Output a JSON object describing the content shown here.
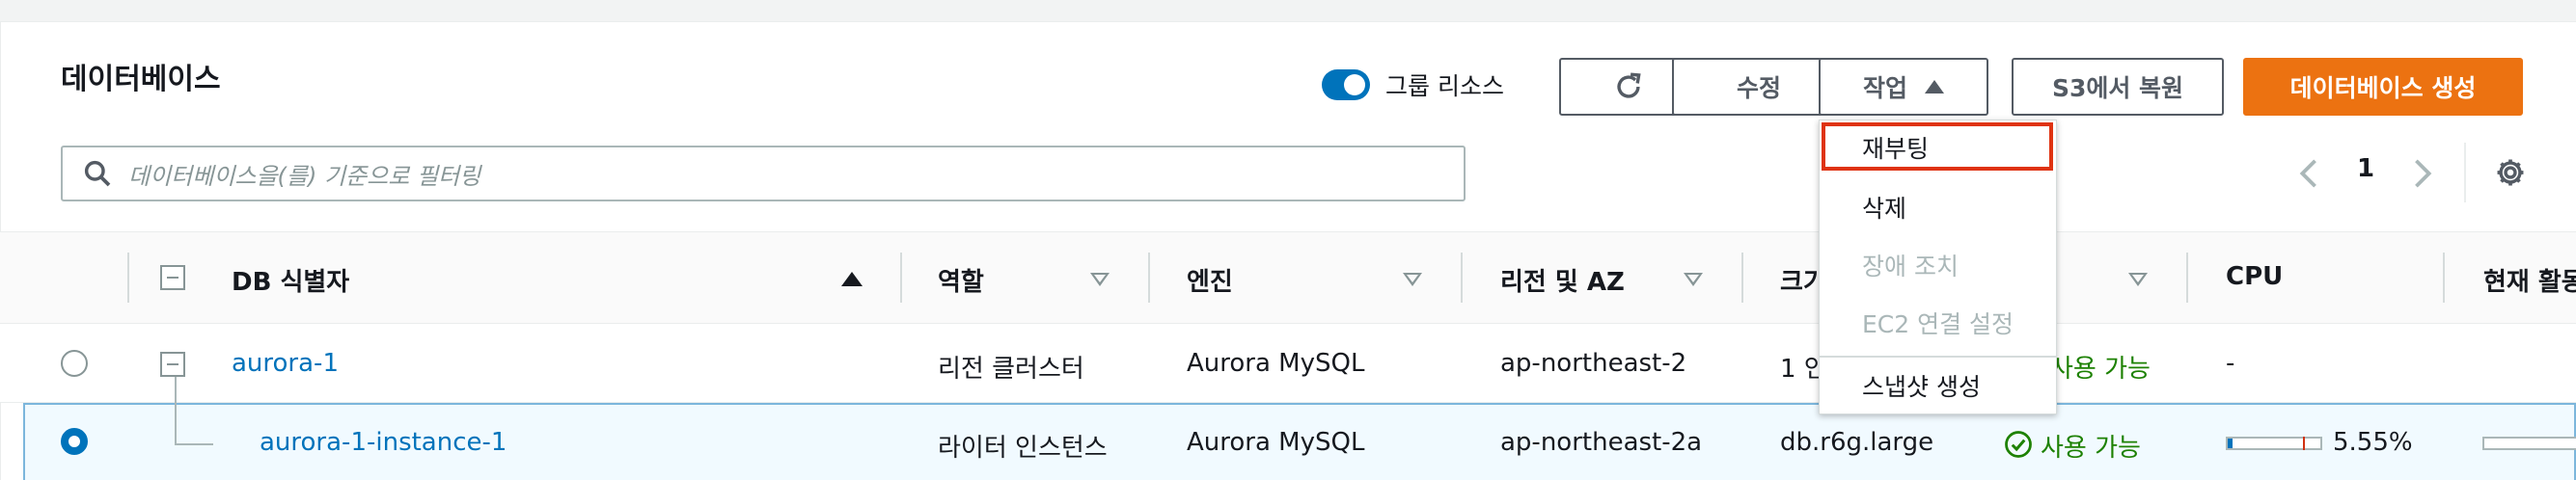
{
  "header": {
    "title": "데이터베이스",
    "group_toggle_label": "그룹 리소스",
    "buttons": {
      "modify": "수정",
      "actions": "작업",
      "restore_s3": "S3에서 복원",
      "create": "데이터베이스 생성"
    }
  },
  "filter": {
    "placeholder": "데이터베이스을(를) 기준으로 필터링"
  },
  "pager": {
    "page": "1"
  },
  "columns": {
    "db_id": "DB 식별자",
    "role": "역할",
    "engine": "엔진",
    "region": "리전 및 AZ",
    "size": "크기",
    "cpu": "CPU",
    "activity": "현재 활동"
  },
  "rows": [
    {
      "db_id": "aurora-1",
      "role": "리전 클러스터",
      "engine": "Aurora MySQL",
      "region": "ap-northeast-2",
      "size": "1 인",
      "status": "사용 가능",
      "cpu": "-"
    },
    {
      "db_id": "aurora-1-instance-1",
      "role": "라이터 인스턴스",
      "engine": "Aurora MySQL",
      "region": "ap-northeast-2a",
      "size": "db.r6g.large",
      "status": "사용 가능",
      "cpu": "5.55%",
      "cpu_fraction": 0.0555
    }
  ],
  "dropdown": {
    "items": [
      "재부팅",
      "삭제",
      "장애 조치",
      "EC2 연결 설정",
      "스냅샷 생성"
    ],
    "disabled": [
      "장애 조치",
      "EC2 연결 설정"
    ],
    "highlighted": "재부팅"
  },
  "colors": {
    "primary": "#ec7211",
    "link": "#0073bb",
    "success": "#1d8102",
    "highlight": "#df3312"
  }
}
